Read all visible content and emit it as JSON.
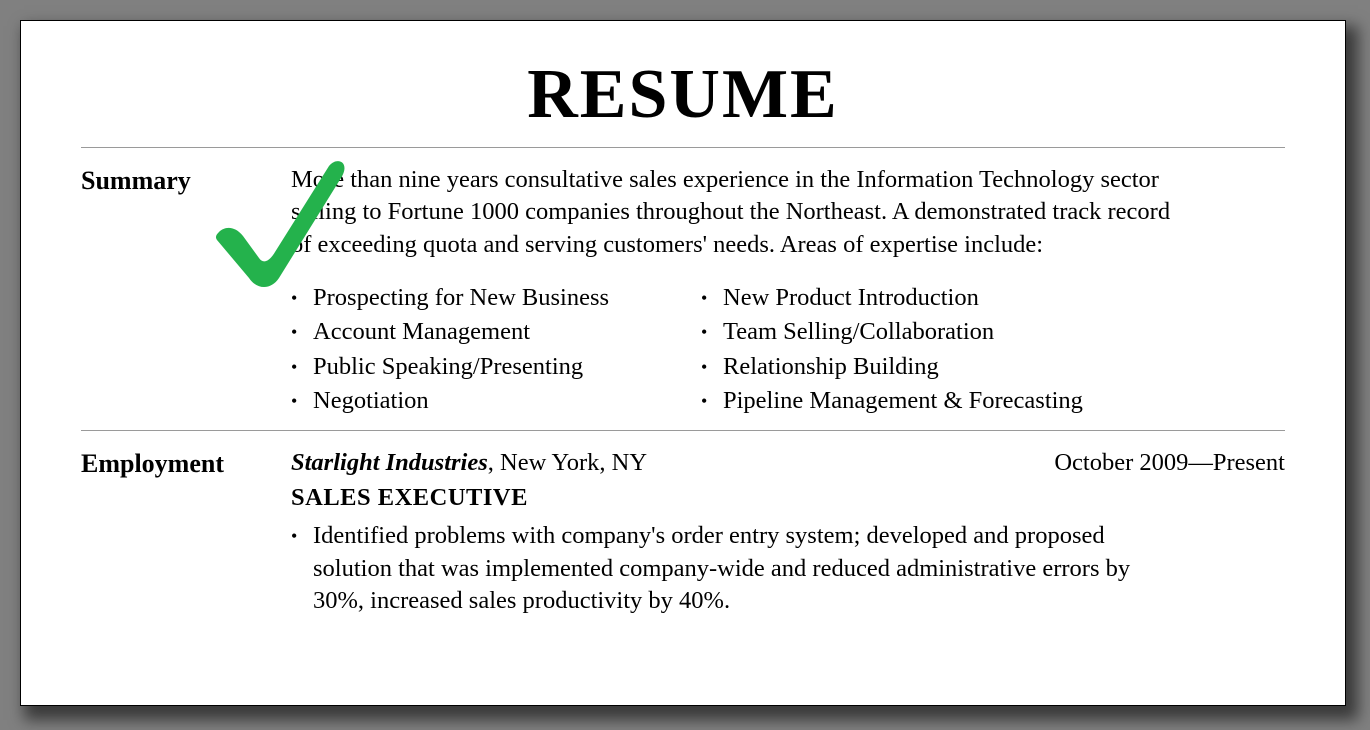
{
  "title": "RESUME",
  "sections": {
    "summary": {
      "label": "Summary",
      "text": "More than nine years consultative sales experience in the Information Technology sector selling to Fortune 1000 companies throughout the Northeast. A demonstrated track record of exceeding quota and serving customers' needs. Areas of expertise include:",
      "expertise_left": [
        "Prospecting for New Business",
        "Account Management",
        "Public Speaking/Presenting",
        "Negotiation"
      ],
      "expertise_right": [
        "New Product Introduction",
        "Team Selling/Collaboration",
        "Relationship Building",
        "Pipeline Management & Forecasting"
      ]
    },
    "employment": {
      "label": "Employment",
      "company": "Starlight Industries",
      "location": ", New York, NY",
      "dates": "October 2009—Present",
      "role": "SALES EXECUTIVE",
      "bullets": [
        "Identified problems with company's  order entry system; developed and proposed solution that was implemented company-wide and reduced administrative errors by 30%, increased sales productivity by 40%."
      ]
    }
  },
  "icons": {
    "checkmark_color": "#24b24c"
  }
}
